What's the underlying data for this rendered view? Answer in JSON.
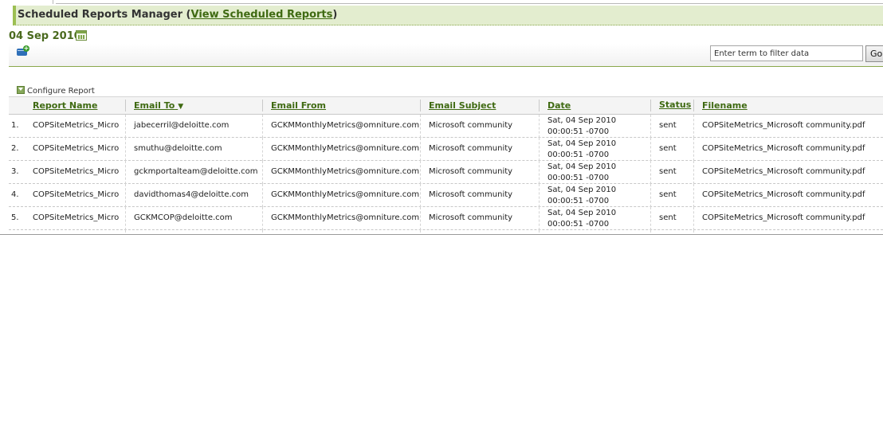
{
  "page": {
    "title_prefix": "Scheduled Reports Manager (",
    "title_link": "View Scheduled Reports",
    "title_suffix": ")",
    "date": "04 Sep 2010"
  },
  "filter": {
    "placeholder": "Enter term to filter data",
    "value": "Enter term to filter data",
    "go_label": "Go"
  },
  "configure_label": "Configure Report",
  "table": {
    "headers": [
      "Report Name",
      "Email To",
      "Email From",
      "Email Subject",
      "Date",
      "Status",
      "Filename"
    ],
    "sort_indicator": "▼",
    "rows": [
      {
        "num": "1.",
        "report": "COPSiteMetrics_Micro",
        "to": "jabecerril@deloitte.com",
        "from": "GCKMMonthlyMetrics@omniture.com",
        "subject": "Microsoft community",
        "date1": "Sat, 04 Sep 2010",
        "date2": "00:00:51 -0700",
        "status": "sent",
        "file": "COPSiteMetrics_Microsoft community.pdf"
      },
      {
        "num": "2.",
        "report": "COPSiteMetrics_Micro",
        "to": "smuthu@deloitte.com",
        "from": "GCKMMonthlyMetrics@omniture.com",
        "subject": "Microsoft community",
        "date1": "Sat, 04 Sep 2010",
        "date2": "00:00:51 -0700",
        "status": "sent",
        "file": "COPSiteMetrics_Microsoft community.pdf"
      },
      {
        "num": "3.",
        "report": "COPSiteMetrics_Micro",
        "to": "gckmportalteam@deloitte.com",
        "from": "GCKMMonthlyMetrics@omniture.com",
        "subject": "Microsoft community",
        "date1": "Sat, 04 Sep 2010",
        "date2": "00:00:51 -0700",
        "status": "sent",
        "file": "COPSiteMetrics_Microsoft community.pdf"
      },
      {
        "num": "4.",
        "report": "COPSiteMetrics_Micro",
        "to": "davidthomas4@deloitte.com",
        "from": "GCKMMonthlyMetrics@omniture.com",
        "subject": "Microsoft community",
        "date1": "Sat, 04 Sep 2010",
        "date2": "00:00:51 -0700",
        "status": "sent",
        "file": "COPSiteMetrics_Microsoft community.pdf"
      },
      {
        "num": "5.",
        "report": "COPSiteMetrics_Micro",
        "to": "GCKMCOP@deloitte.com",
        "from": "GCKMMonthlyMetrics@omniture.com",
        "subject": "Microsoft community",
        "date1": "Sat, 04 Sep 2010",
        "date2": "00:00:51 -0700",
        "status": "sent",
        "file": "COPSiteMetrics_Microsoft community.pdf"
      }
    ]
  }
}
